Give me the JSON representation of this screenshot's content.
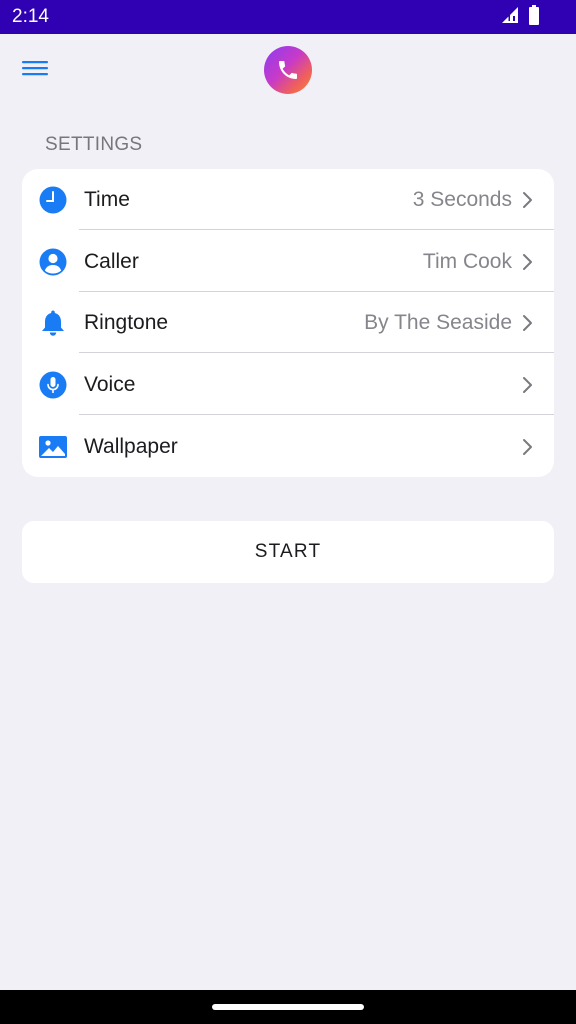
{
  "status_bar": {
    "time": "2:14",
    "icons": [
      "signal-icon",
      "battery-icon"
    ]
  },
  "header": {
    "menu_icon": "hamburger-menu-icon",
    "logo_icon": "phone-icon"
  },
  "settings": {
    "section_title": "SETTINGS",
    "items": [
      {
        "label": "Time",
        "value": "3 Seconds",
        "icon": "clock-icon"
      },
      {
        "label": "Caller",
        "value": "Tim Cook",
        "icon": "person-icon"
      },
      {
        "label": "Ringtone",
        "value": "By The Seaside",
        "icon": "bell-icon"
      },
      {
        "label": "Voice",
        "value": "",
        "icon": "microphone-icon"
      },
      {
        "label": "Wallpaper",
        "value": "",
        "icon": "image-icon"
      }
    ]
  },
  "start_button": {
    "label": "START"
  },
  "colors": {
    "status_bar": "#3000b3",
    "accent": "#1a7cf5",
    "background": "#f1f0f6",
    "card": "#ffffff",
    "secondary_text": "#86858c"
  }
}
